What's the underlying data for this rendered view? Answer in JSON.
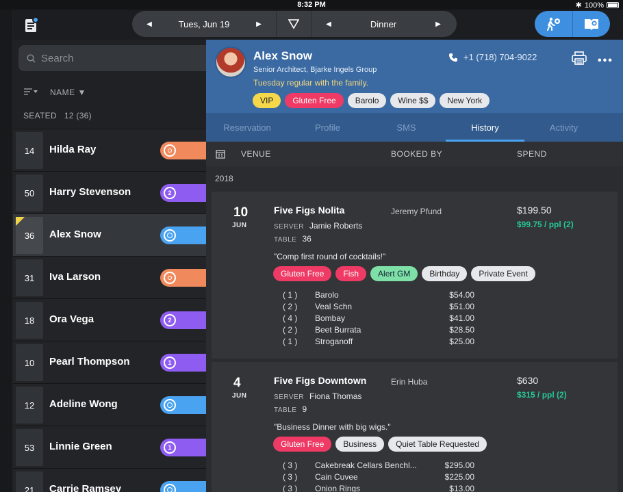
{
  "status": {
    "time": "8:32 PM",
    "battery": "100%"
  },
  "toolbar": {
    "date": "Tues, Jun 19",
    "shift": "Dinner"
  },
  "list": {
    "search_placeholder": "Search",
    "sort_label": "NAME",
    "seated_label": "SEATED",
    "seated_count": "12 (36)",
    "rows": [
      {
        "table": "14",
        "name": "Hilda Ray",
        "color": "#f08a5d",
        "badge": "target"
      },
      {
        "table": "50",
        "name": "Harry Stevenson",
        "color": "#8e5cf0",
        "badge": "2"
      },
      {
        "table": "36",
        "name": "Alex Snow",
        "color": "#4aa3f0",
        "badge": "ring",
        "selected": true,
        "flag": true
      },
      {
        "table": "31",
        "name": "Iva Larson",
        "color": "#f08a5d",
        "badge": "target"
      },
      {
        "table": "18",
        "name": "Ora Vega",
        "color": "#8e5cf0",
        "badge": "2"
      },
      {
        "table": "10",
        "name": "Pearl Thompson",
        "color": "#8e5cf0",
        "badge": "1"
      },
      {
        "table": "12",
        "name": "Adeline Wong",
        "color": "#4aa3f0",
        "badge": "ring"
      },
      {
        "table": "53",
        "name": "Linnie Green",
        "color": "#8e5cf0",
        "badge": "1"
      },
      {
        "table": "21",
        "name": "Carrie Ramsey",
        "color": "#4aa3f0",
        "badge": "ring"
      }
    ]
  },
  "profile": {
    "name": "Alex Snow",
    "title": "Senior Architect, Bjarke Ingels Group",
    "note": "Tuesday regular with the family.",
    "phone": "+1 (718) 704-9022",
    "tags": [
      {
        "label": "VIP",
        "style": "yellow"
      },
      {
        "label": "Gluten Free",
        "style": "pink"
      },
      {
        "label": "Barolo",
        "style": "white"
      },
      {
        "label": "Wine $$",
        "style": "white"
      },
      {
        "label": "New York",
        "style": "white"
      }
    ]
  },
  "tabs": [
    "Reservation",
    "Profile",
    "SMS",
    "History",
    "Activity"
  ],
  "active_tab": "History",
  "history": {
    "col_venue": "VENUE",
    "col_booked_by": "BOOKED BY",
    "col_spend": "SPEND",
    "year": "2018",
    "server_label": "SERVER",
    "table_label": "TABLE",
    "visits": [
      {
        "day": "10",
        "month": "JUN",
        "venue": "Five Figs Nolita",
        "booked_by": "Jeremy Pfund",
        "spend": "$199.50",
        "per_person": "$99.75 / ppl (2)",
        "server": "Jamie Roberts",
        "table": "36",
        "note": "\"Comp first round of cocktails!\"",
        "tags": [
          {
            "label": "Gluten Free",
            "style": "pink"
          },
          {
            "label": "Fish",
            "style": "pink"
          },
          {
            "label": "Alert GM",
            "style": "green"
          },
          {
            "label": "Birthday",
            "style": "white"
          },
          {
            "label": "Private Event",
            "style": "white"
          }
        ],
        "items": [
          {
            "qty": "( 1 )",
            "name": "Barolo",
            "price": "$54.00"
          },
          {
            "qty": "( 2 )",
            "name": "Veal Schn",
            "price": "$51.00"
          },
          {
            "qty": "( 4 )",
            "name": "Bombay",
            "price": "$41.00"
          },
          {
            "qty": "( 2 )",
            "name": "Beet Burrata",
            "price": "$28.50"
          },
          {
            "qty": "( 1 )",
            "name": "Stroganoff",
            "price": "$25.00"
          }
        ]
      },
      {
        "day": "4",
        "month": "JUN",
        "venue": "Five Figs Downtown",
        "booked_by": "Erin Huba",
        "spend": "$630",
        "per_person": "$315 / ppl (2)",
        "server": "Fiona Thomas",
        "table": "9",
        "note": "\"Business Dinner with big wigs.\"",
        "tags": [
          {
            "label": "Gluten Free",
            "style": "pink"
          },
          {
            "label": "Business",
            "style": "white"
          },
          {
            "label": "Quiet Table Requested",
            "style": "white"
          }
        ],
        "items": [
          {
            "qty": "( 3 )",
            "name": "Cakebreak Cellars Benchl...",
            "price": "$295.00"
          },
          {
            "qty": "( 3 )",
            "name": "Cain Cuvee",
            "price": "$225.00"
          },
          {
            "qty": "( 3 )",
            "name": "Onion Rings",
            "price": "$13.00"
          }
        ]
      }
    ]
  }
}
